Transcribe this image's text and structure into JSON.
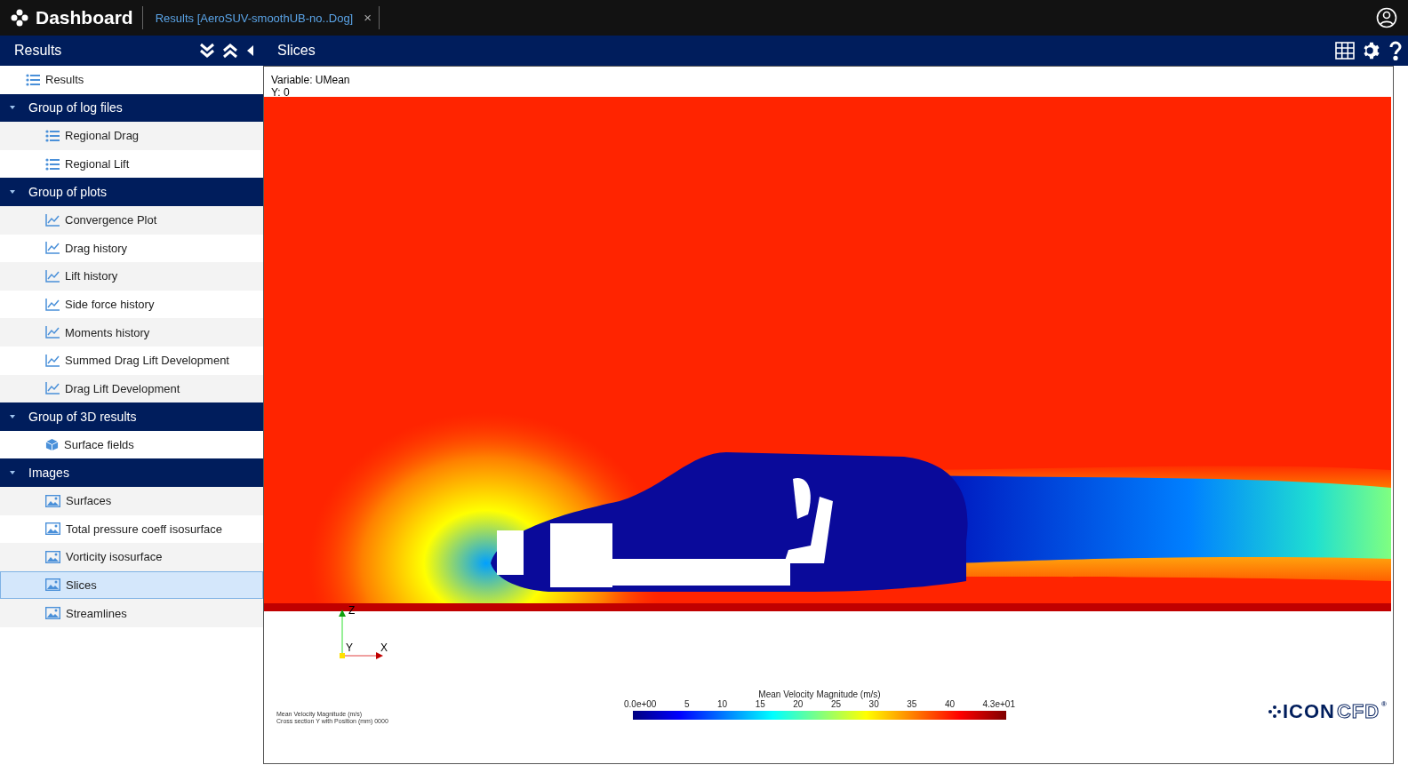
{
  "topbar": {
    "app_title": "Dashboard",
    "tab": "Results [AeroSUV-smoothUB-no..Dog]",
    "tab_close": "×"
  },
  "sidebar": {
    "title": "Results",
    "root": {
      "label": "Results",
      "kind": "list"
    },
    "groups": [
      {
        "label": "Group of log files",
        "expanded": true,
        "children": [
          {
            "label": "Regional Drag",
            "kind": "list",
            "selected": false
          },
          {
            "label": "Regional Lift",
            "kind": "list",
            "selected": false
          }
        ]
      },
      {
        "label": "Group of plots",
        "expanded": true,
        "children": [
          {
            "label": "Convergence Plot",
            "kind": "plot",
            "selected": false
          },
          {
            "label": "Drag history",
            "kind": "plot",
            "selected": false
          },
          {
            "label": "Lift history",
            "kind": "plot",
            "selected": false
          },
          {
            "label": "Side force history",
            "kind": "plot",
            "selected": false
          },
          {
            "label": "Moments history",
            "kind": "plot",
            "selected": false
          },
          {
            "label": "Summed Drag Lift Development",
            "kind": "plot",
            "selected": false
          },
          {
            "label": "Drag Lift Development",
            "kind": "plot",
            "selected": false
          }
        ]
      },
      {
        "label": "Group of 3D results",
        "expanded": true,
        "children": [
          {
            "label": "Surface fields",
            "kind": "cube",
            "selected": false
          }
        ]
      },
      {
        "label": "Images",
        "expanded": true,
        "children": [
          {
            "label": "Surfaces",
            "kind": "image",
            "selected": false
          },
          {
            "label": "Total pressure coeff isosurface",
            "kind": "image",
            "selected": false
          },
          {
            "label": "Vorticity isosurface",
            "kind": "image",
            "selected": false
          },
          {
            "label": "Slices",
            "kind": "image",
            "selected": true
          },
          {
            "label": "Streamlines",
            "kind": "image",
            "selected": false
          }
        ]
      }
    ]
  },
  "main": {
    "title": "Slices",
    "variable": "Variable: UMean",
    "position": "Y: 0",
    "axes": {
      "z": "Z",
      "y": "Y",
      "x": "X"
    },
    "caption": [
      "Mean Velocity Magnitude (m/s)",
      "Cross section Y with Position (mm) 0000"
    ],
    "colorbar": {
      "title": "Mean Velocity Magnitude (m/s)",
      "ticks": [
        "0.0e+00",
        "5",
        "10",
        "15",
        "20",
        "25",
        "30",
        "35",
        "40",
        "4.3e+01"
      ]
    },
    "logo": {
      "left": "ICON",
      "right": "CFD",
      "mark": "®"
    }
  }
}
